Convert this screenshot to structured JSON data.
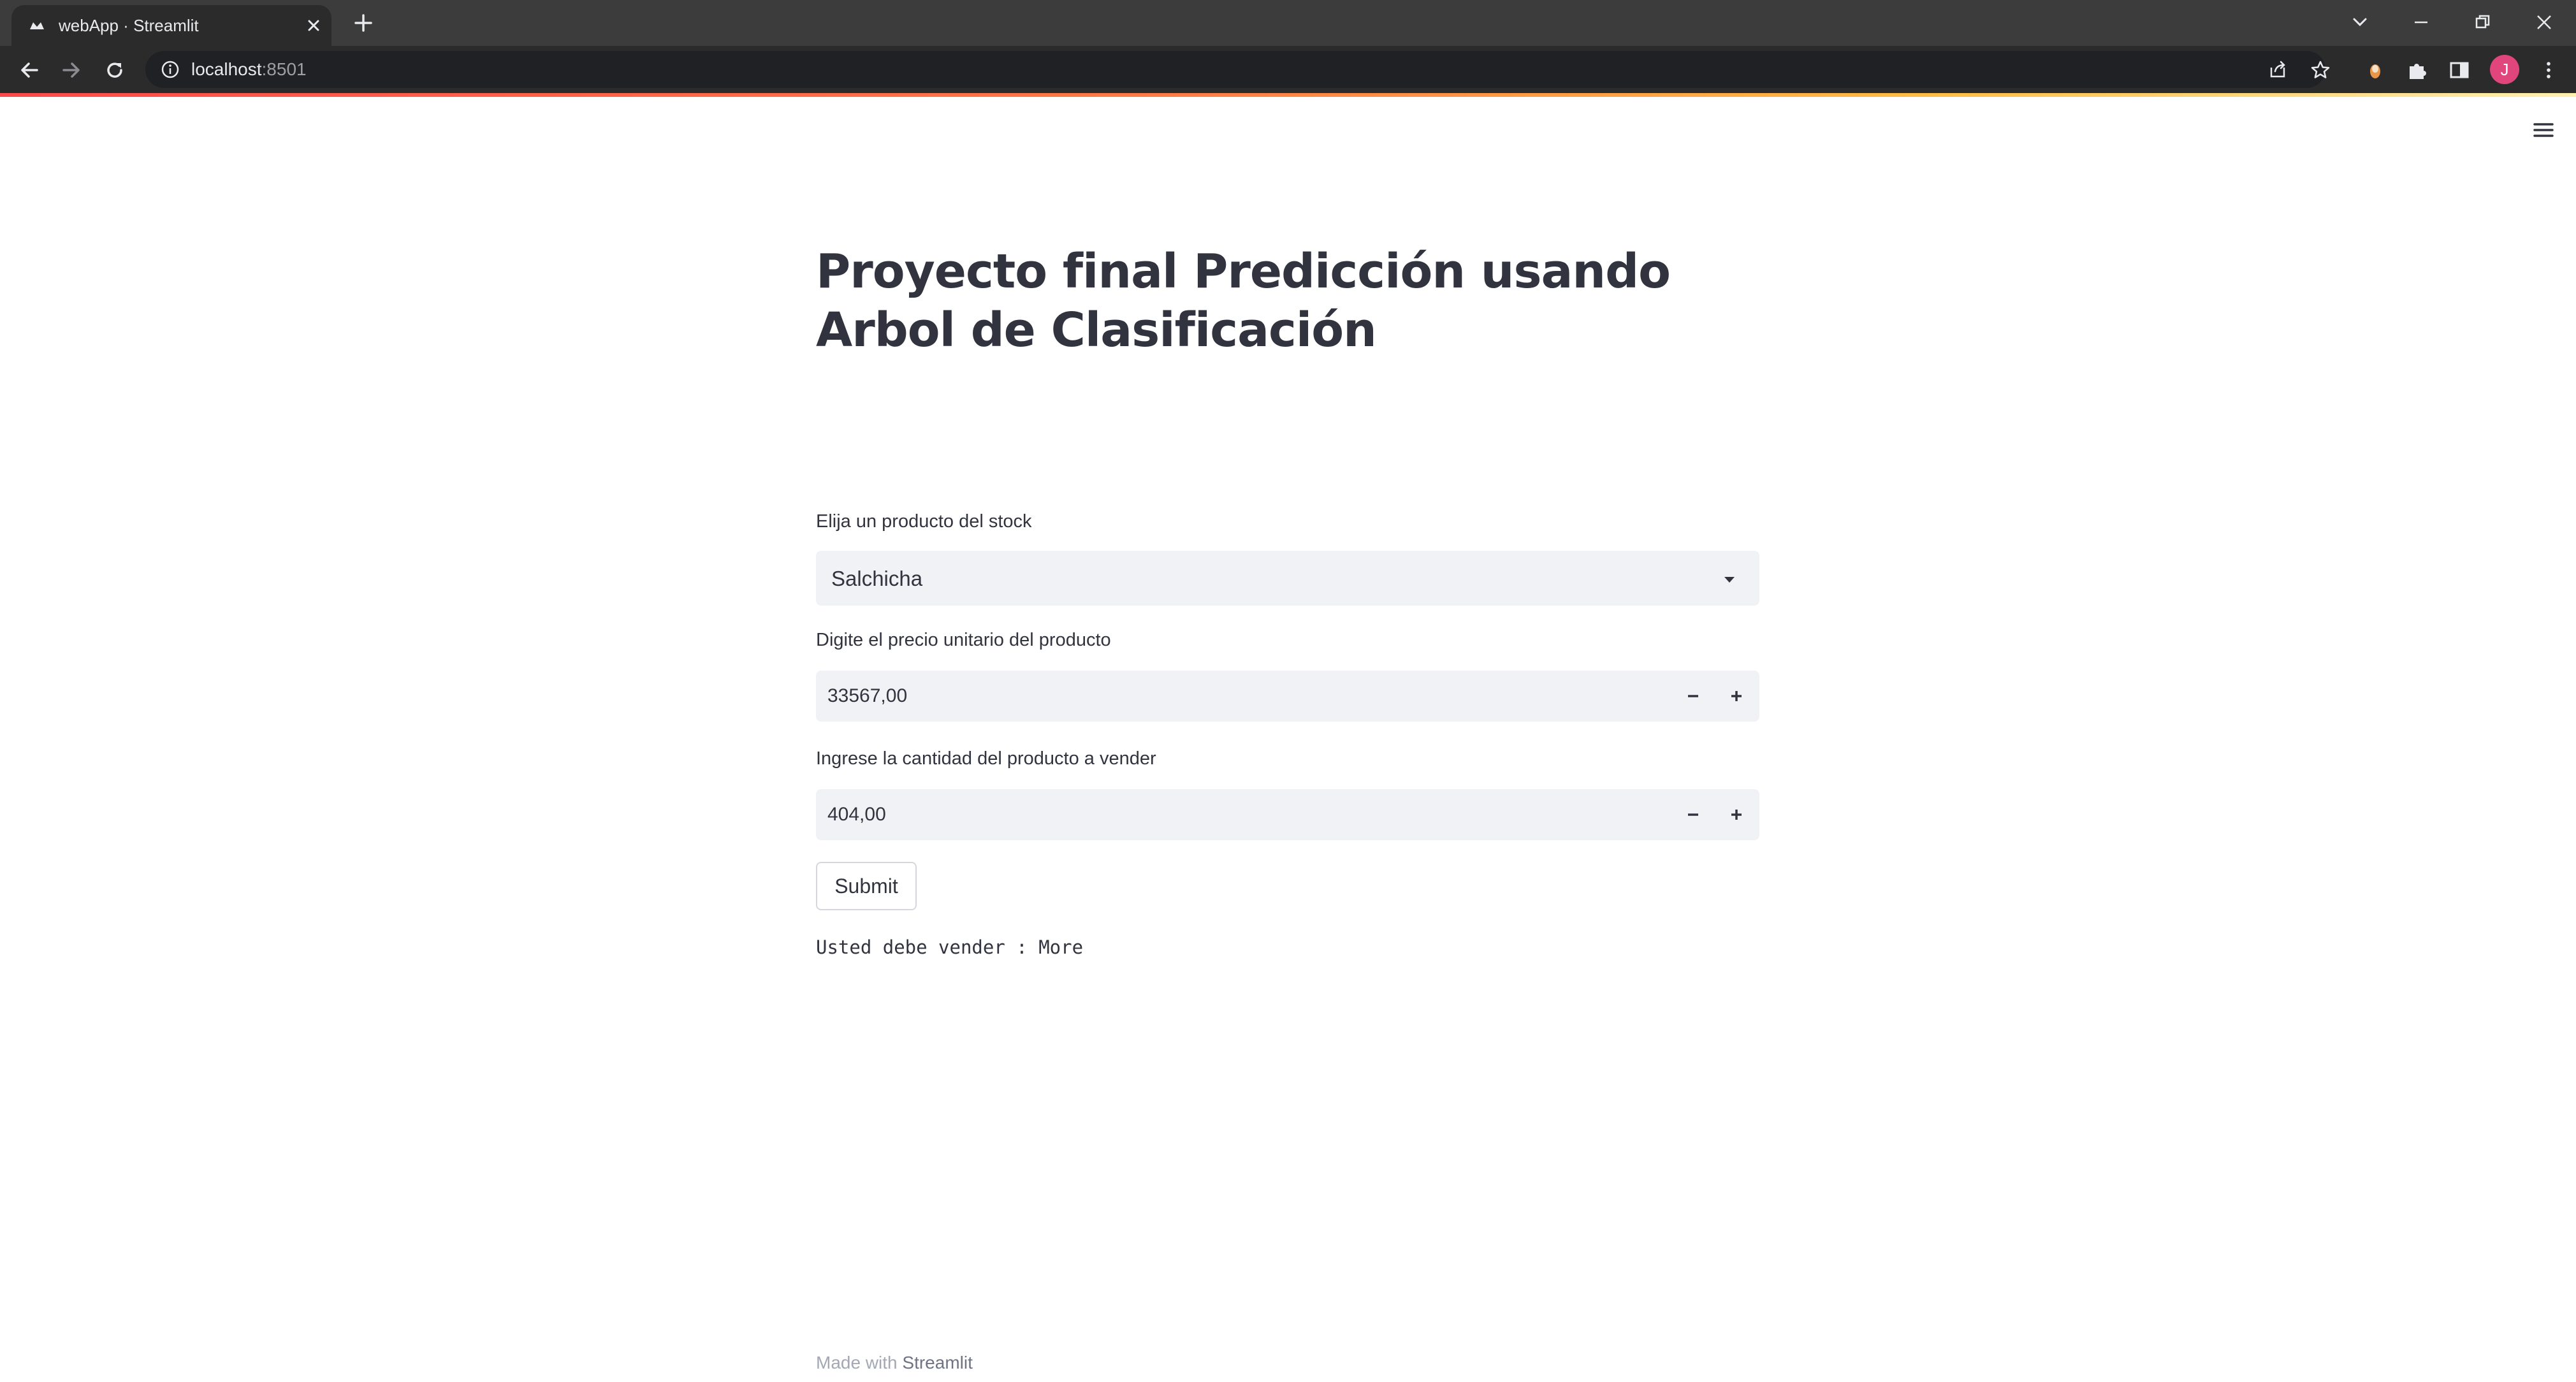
{
  "browser": {
    "tab_title": "webApp · Streamlit",
    "url_host": "localhost",
    "url_port": ":8501",
    "profile_initial": "J"
  },
  "app": {
    "title": "Proyecto final Predicción usando Arbol de Clasificación",
    "product_select": {
      "label": "Elija un producto del stock",
      "value": "Salchicha"
    },
    "price_input": {
      "label": "Digite el precio unitario del producto",
      "value": "33567,00"
    },
    "quantity_input": {
      "label": "Ingrese la cantidad del producto a vender",
      "value": "404,00"
    },
    "submit_label": "Submit",
    "result_text": "Usted debe vender : More",
    "footer": {
      "prefix": "Made with",
      "link": "Streamlit"
    }
  },
  "colors": {
    "text": "#31333f",
    "input_bg": "#f0f2f6",
    "accent": "#ff4b4b"
  }
}
